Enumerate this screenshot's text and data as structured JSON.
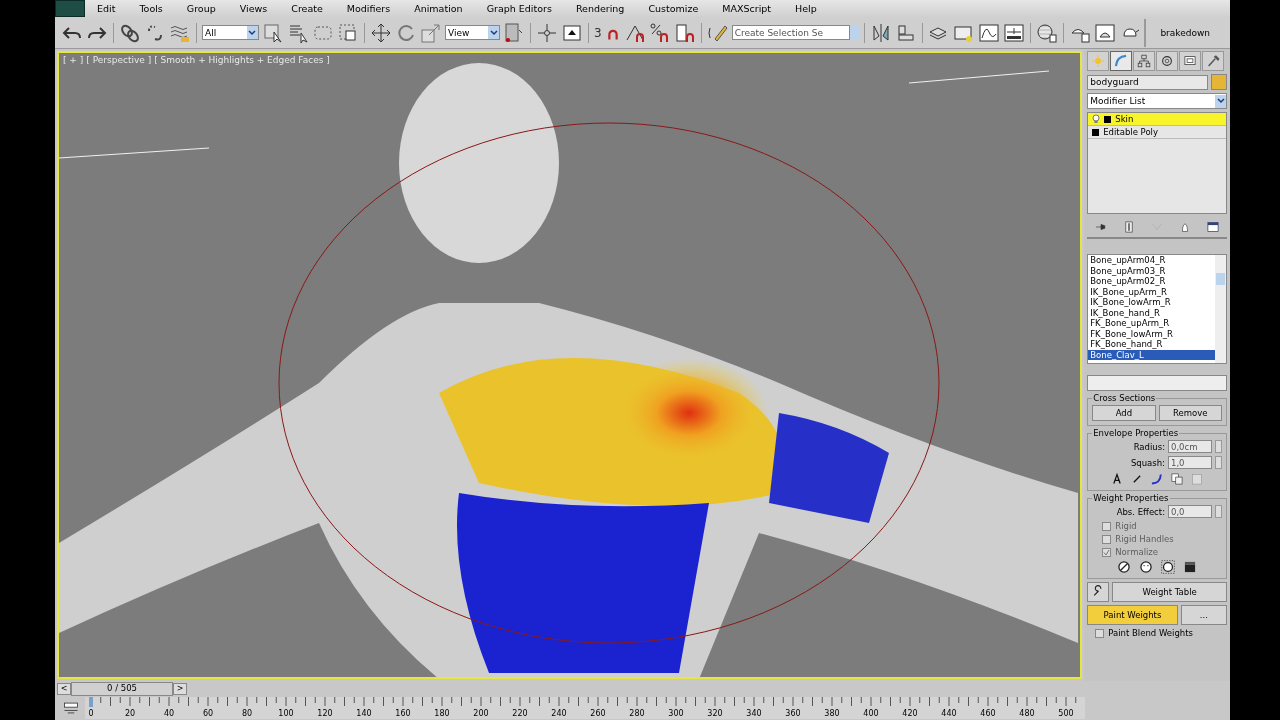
{
  "menu": [
    "Edit",
    "Tools",
    "Group",
    "Views",
    "Create",
    "Modifiers",
    "Animation",
    "Graph Editors",
    "Rendering",
    "Customize",
    "MAXScript",
    "Help"
  ],
  "toolbar": {
    "selection_filter": "All",
    "reference_coordinate": "View",
    "snap_label": "3",
    "named_selection": {
      "placeholder": "Create Selection Se"
    },
    "workspace": "brakedown"
  },
  "viewport": {
    "labels": [
      "[ + ]",
      "[ Perspective ]",
      "[ Smooth + Highlights + Edged Faces ]"
    ]
  },
  "command_panel": {
    "tabs": [
      {
        "kind": "create",
        "selected": false
      },
      {
        "kind": "modify",
        "selected": true
      },
      {
        "kind": "hierarchy",
        "selected": false
      },
      {
        "kind": "motion",
        "selected": false
      },
      {
        "kind": "display",
        "selected": false
      },
      {
        "kind": "utilities",
        "selected": false
      }
    ],
    "object_name": "bodyguard",
    "modifier_list": "Modifier List",
    "stack": [
      {
        "label": "Skin",
        "selected": true
      },
      {
        "label": "Editable Poly",
        "selected": false
      }
    ],
    "bones": [
      {
        "name": "Bone_upArm04_R",
        "selected": false
      },
      {
        "name": "Bone_upArm03_R",
        "selected": false
      },
      {
        "name": "Bone_upArm02_R",
        "selected": false
      },
      {
        "name": "IK_Bone_upArm_R",
        "selected": false
      },
      {
        "name": "IK_Bone_lowArm_R",
        "selected": false
      },
      {
        "name": "IK_Bone_hand_R",
        "selected": false
      },
      {
        "name": "FK_Bone_upArm_R",
        "selected": false
      },
      {
        "name": "FK_Bone_lowArm_R",
        "selected": false
      },
      {
        "name": "FK_Bone_hand_R",
        "selected": false
      },
      {
        "name": "Bone_Clav_L",
        "selected": true
      }
    ],
    "cross_sections": {
      "title": "Cross Sections",
      "buttons": [
        "Add",
        "Remove"
      ]
    },
    "envelope_properties": {
      "title": "Envelope Properties",
      "fields": [
        {
          "label": "Radius:",
          "value": "0,0cm"
        },
        {
          "label": "Squash:",
          "value": "1,0"
        }
      ]
    },
    "weight_properties": {
      "title": "Weight Properties",
      "abs_effect": {
        "label": "Abs. Effect:",
        "value": "0,0"
      },
      "options": [
        {
          "label": "Rigid",
          "checked": false,
          "disabled": true
        },
        {
          "label": "Rigid Handles",
          "checked": false,
          "disabled": true
        },
        {
          "label": "Normalize",
          "checked": true,
          "disabled": true
        }
      ]
    },
    "weight_table": "Weight Table",
    "paint_weights": {
      "label": "Paint Weights",
      "active": true
    },
    "paint_options": "...",
    "paint_blend_weights": {
      "label": "Paint Blend Weights",
      "checked": false,
      "disabled": false
    }
  },
  "time_slider": {
    "prev": "<",
    "frame": "0 / 505",
    "next": ">",
    "level": 0
  },
  "track_bar": {
    "labels": [
      "0",
      "20",
      "40",
      "60",
      "80",
      "100",
      "120",
      "140",
      "160",
      "180",
      "200",
      "220",
      "240",
      "260",
      "280",
      "300",
      "320",
      "340",
      "360",
      "380",
      "400",
      "420",
      "440",
      "460",
      "480",
      "500"
    ]
  }
}
